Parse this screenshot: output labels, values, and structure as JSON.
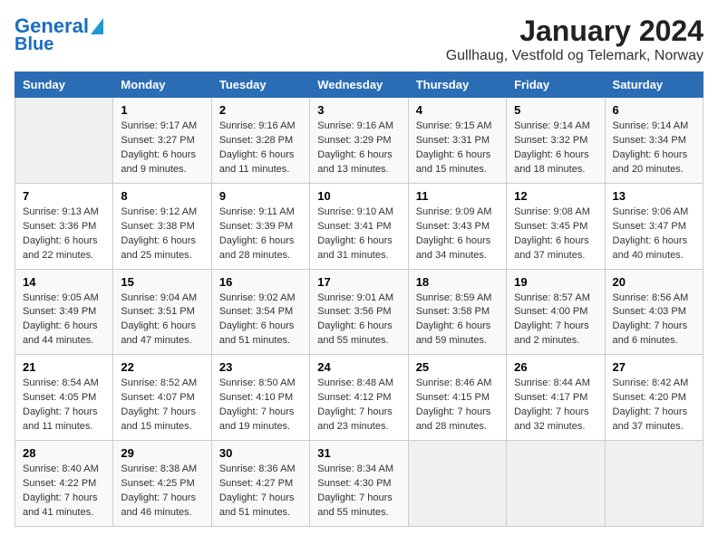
{
  "logo": {
    "part1": "General",
    "part2": "Blue"
  },
  "title": "January 2024",
  "subtitle": "Gullhaug, Vestfold og Telemark, Norway",
  "headers": [
    "Sunday",
    "Monday",
    "Tuesday",
    "Wednesday",
    "Thursday",
    "Friday",
    "Saturday"
  ],
  "weeks": [
    [
      {
        "day": "",
        "sunrise": "",
        "sunset": "",
        "daylight": ""
      },
      {
        "day": "1",
        "sunrise": "Sunrise: 9:17 AM",
        "sunset": "Sunset: 3:27 PM",
        "daylight": "Daylight: 6 hours and 9 minutes."
      },
      {
        "day": "2",
        "sunrise": "Sunrise: 9:16 AM",
        "sunset": "Sunset: 3:28 PM",
        "daylight": "Daylight: 6 hours and 11 minutes."
      },
      {
        "day": "3",
        "sunrise": "Sunrise: 9:16 AM",
        "sunset": "Sunset: 3:29 PM",
        "daylight": "Daylight: 6 hours and 13 minutes."
      },
      {
        "day": "4",
        "sunrise": "Sunrise: 9:15 AM",
        "sunset": "Sunset: 3:31 PM",
        "daylight": "Daylight: 6 hours and 15 minutes."
      },
      {
        "day": "5",
        "sunrise": "Sunrise: 9:14 AM",
        "sunset": "Sunset: 3:32 PM",
        "daylight": "Daylight: 6 hours and 18 minutes."
      },
      {
        "day": "6",
        "sunrise": "Sunrise: 9:14 AM",
        "sunset": "Sunset: 3:34 PM",
        "daylight": "Daylight: 6 hours and 20 minutes."
      }
    ],
    [
      {
        "day": "7",
        "sunrise": "Sunrise: 9:13 AM",
        "sunset": "Sunset: 3:36 PM",
        "daylight": "Daylight: 6 hours and 22 minutes."
      },
      {
        "day": "8",
        "sunrise": "Sunrise: 9:12 AM",
        "sunset": "Sunset: 3:38 PM",
        "daylight": "Daylight: 6 hours and 25 minutes."
      },
      {
        "day": "9",
        "sunrise": "Sunrise: 9:11 AM",
        "sunset": "Sunset: 3:39 PM",
        "daylight": "Daylight: 6 hours and 28 minutes."
      },
      {
        "day": "10",
        "sunrise": "Sunrise: 9:10 AM",
        "sunset": "Sunset: 3:41 PM",
        "daylight": "Daylight: 6 hours and 31 minutes."
      },
      {
        "day": "11",
        "sunrise": "Sunrise: 9:09 AM",
        "sunset": "Sunset: 3:43 PM",
        "daylight": "Daylight: 6 hours and 34 minutes."
      },
      {
        "day": "12",
        "sunrise": "Sunrise: 9:08 AM",
        "sunset": "Sunset: 3:45 PM",
        "daylight": "Daylight: 6 hours and 37 minutes."
      },
      {
        "day": "13",
        "sunrise": "Sunrise: 9:06 AM",
        "sunset": "Sunset: 3:47 PM",
        "daylight": "Daylight: 6 hours and 40 minutes."
      }
    ],
    [
      {
        "day": "14",
        "sunrise": "Sunrise: 9:05 AM",
        "sunset": "Sunset: 3:49 PM",
        "daylight": "Daylight: 6 hours and 44 minutes."
      },
      {
        "day": "15",
        "sunrise": "Sunrise: 9:04 AM",
        "sunset": "Sunset: 3:51 PM",
        "daylight": "Daylight: 6 hours and 47 minutes."
      },
      {
        "day": "16",
        "sunrise": "Sunrise: 9:02 AM",
        "sunset": "Sunset: 3:54 PM",
        "daylight": "Daylight: 6 hours and 51 minutes."
      },
      {
        "day": "17",
        "sunrise": "Sunrise: 9:01 AM",
        "sunset": "Sunset: 3:56 PM",
        "daylight": "Daylight: 6 hours and 55 minutes."
      },
      {
        "day": "18",
        "sunrise": "Sunrise: 8:59 AM",
        "sunset": "Sunset: 3:58 PM",
        "daylight": "Daylight: 6 hours and 59 minutes."
      },
      {
        "day": "19",
        "sunrise": "Sunrise: 8:57 AM",
        "sunset": "Sunset: 4:00 PM",
        "daylight": "Daylight: 7 hours and 2 minutes."
      },
      {
        "day": "20",
        "sunrise": "Sunrise: 8:56 AM",
        "sunset": "Sunset: 4:03 PM",
        "daylight": "Daylight: 7 hours and 6 minutes."
      }
    ],
    [
      {
        "day": "21",
        "sunrise": "Sunrise: 8:54 AM",
        "sunset": "Sunset: 4:05 PM",
        "daylight": "Daylight: 7 hours and 11 minutes."
      },
      {
        "day": "22",
        "sunrise": "Sunrise: 8:52 AM",
        "sunset": "Sunset: 4:07 PM",
        "daylight": "Daylight: 7 hours and 15 minutes."
      },
      {
        "day": "23",
        "sunrise": "Sunrise: 8:50 AM",
        "sunset": "Sunset: 4:10 PM",
        "daylight": "Daylight: 7 hours and 19 minutes."
      },
      {
        "day": "24",
        "sunrise": "Sunrise: 8:48 AM",
        "sunset": "Sunset: 4:12 PM",
        "daylight": "Daylight: 7 hours and 23 minutes."
      },
      {
        "day": "25",
        "sunrise": "Sunrise: 8:46 AM",
        "sunset": "Sunset: 4:15 PM",
        "daylight": "Daylight: 7 hours and 28 minutes."
      },
      {
        "day": "26",
        "sunrise": "Sunrise: 8:44 AM",
        "sunset": "Sunset: 4:17 PM",
        "daylight": "Daylight: 7 hours and 32 minutes."
      },
      {
        "day": "27",
        "sunrise": "Sunrise: 8:42 AM",
        "sunset": "Sunset: 4:20 PM",
        "daylight": "Daylight: 7 hours and 37 minutes."
      }
    ],
    [
      {
        "day": "28",
        "sunrise": "Sunrise: 8:40 AM",
        "sunset": "Sunset: 4:22 PM",
        "daylight": "Daylight: 7 hours and 41 minutes."
      },
      {
        "day": "29",
        "sunrise": "Sunrise: 8:38 AM",
        "sunset": "Sunset: 4:25 PM",
        "daylight": "Daylight: 7 hours and 46 minutes."
      },
      {
        "day": "30",
        "sunrise": "Sunrise: 8:36 AM",
        "sunset": "Sunset: 4:27 PM",
        "daylight": "Daylight: 7 hours and 51 minutes."
      },
      {
        "day": "31",
        "sunrise": "Sunrise: 8:34 AM",
        "sunset": "Sunset: 4:30 PM",
        "daylight": "Daylight: 7 hours and 55 minutes."
      },
      {
        "day": "",
        "sunrise": "",
        "sunset": "",
        "daylight": ""
      },
      {
        "day": "",
        "sunrise": "",
        "sunset": "",
        "daylight": ""
      },
      {
        "day": "",
        "sunrise": "",
        "sunset": "",
        "daylight": ""
      }
    ]
  ]
}
